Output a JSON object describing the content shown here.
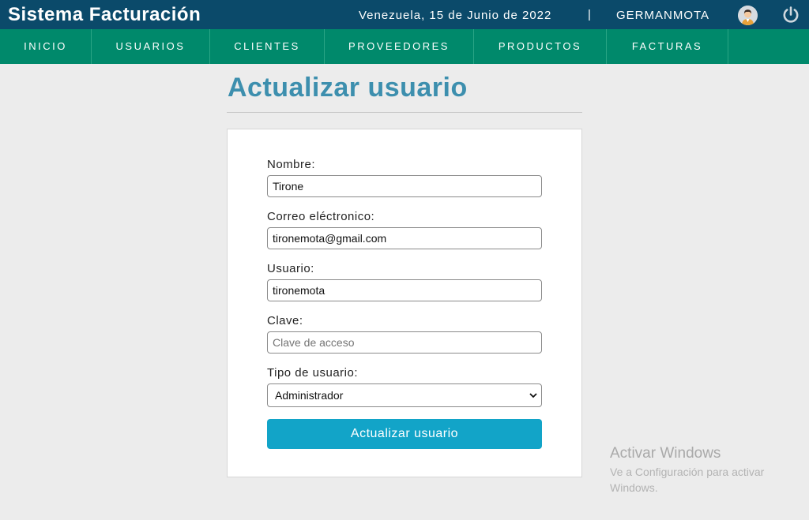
{
  "header": {
    "app_title": "Sistema Facturación",
    "date": "Venezuela, 15 de Junio de 2022",
    "separator": "|",
    "username": "GERMANMOTA",
    "avatar_icon": "user-avatar-icon",
    "logout_icon": "power-icon"
  },
  "nav": {
    "items": [
      {
        "label": "INICIO"
      },
      {
        "label": "USUARIOS"
      },
      {
        "label": "CLIENTES"
      },
      {
        "label": "PROVEEDORES"
      },
      {
        "label": "PRODUCTOS"
      },
      {
        "label": "FACTURAS"
      }
    ]
  },
  "page": {
    "title": "Actualizar usuario"
  },
  "form": {
    "nombre_label": "Nombre:",
    "nombre_value": "Tirone",
    "correo_label": "Correo eléctronico:",
    "correo_value": "tironemota@gmail.com",
    "usuario_label": "Usuario:",
    "usuario_value": "tironemota",
    "clave_label": "Clave:",
    "clave_placeholder": "Clave de acceso",
    "tipo_label": "Tipo de usuario:",
    "tipo_value": "Administrador",
    "submit_label": "Actualizar usuario"
  },
  "watermark": {
    "title": "Activar Windows",
    "subtitle": "Ve a Configuración para activar Windows."
  },
  "colors": {
    "topbar": "#0b4a6a",
    "navbar": "#00896b",
    "title": "#3d8fae",
    "button": "#12a4c8"
  }
}
